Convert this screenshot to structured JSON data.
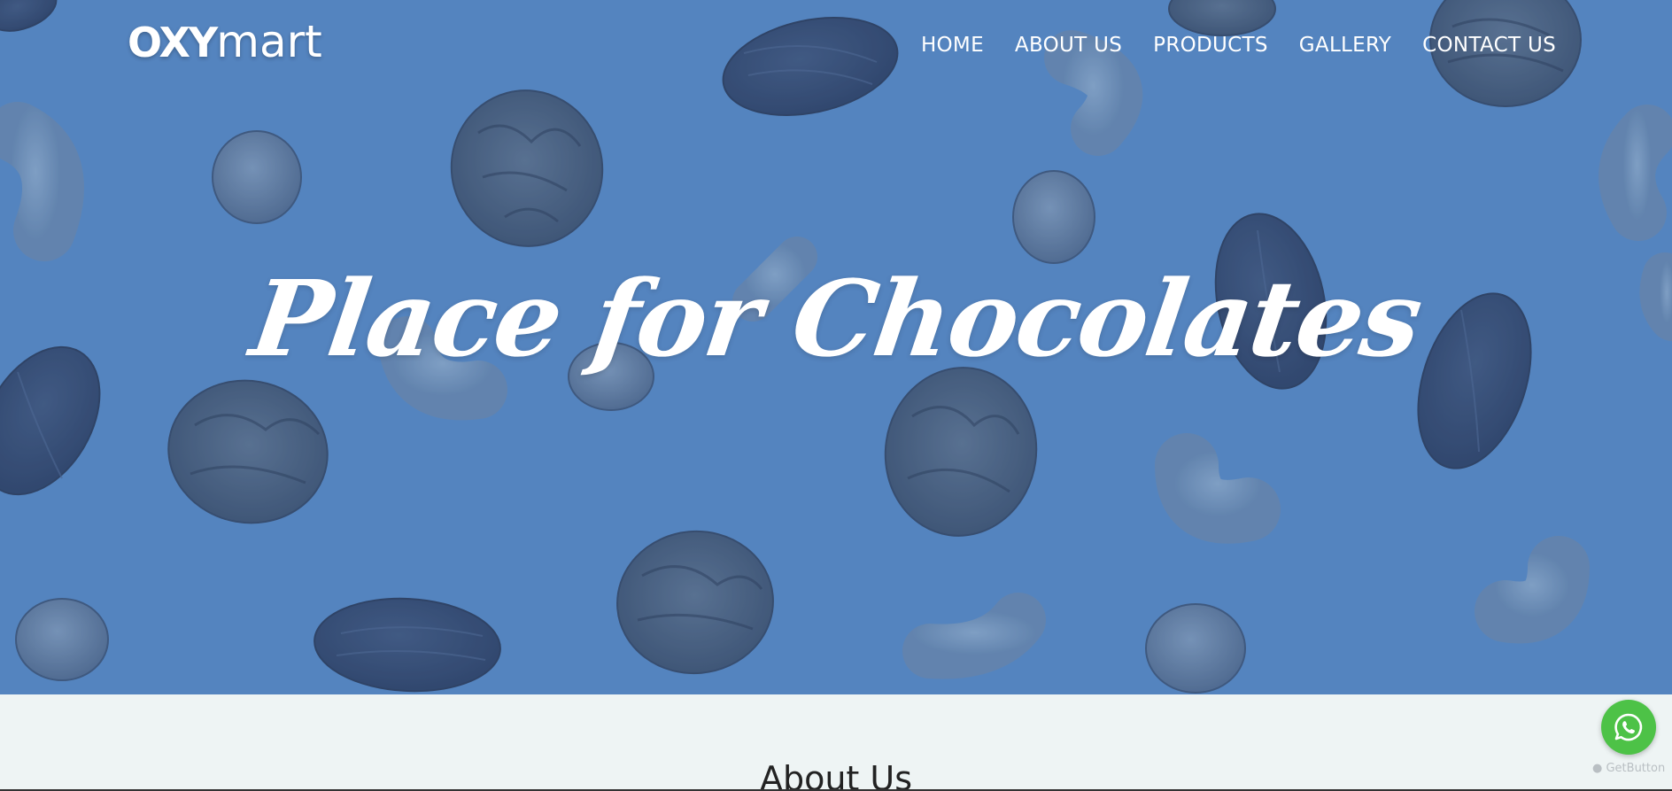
{
  "header": {
    "logo_part1": "OXY",
    "logo_part2": "mart",
    "nav": [
      {
        "label": "HOME"
      },
      {
        "label": "ABOUT US"
      },
      {
        "label": "PRODUCTS"
      },
      {
        "label": "GALLERY"
      },
      {
        "label": "CONTACT US"
      }
    ]
  },
  "hero": {
    "title": "Place for Chocolates",
    "background_description_icon": "nuts-pattern",
    "overlay_color": "#5787c0"
  },
  "about": {
    "title": "About Us",
    "background_color": "#eef4f4"
  },
  "widgets": {
    "whatsapp_icon": "whatsapp-icon",
    "whatsapp_color": "#4dc247",
    "getbutton_label": "GetButton"
  }
}
